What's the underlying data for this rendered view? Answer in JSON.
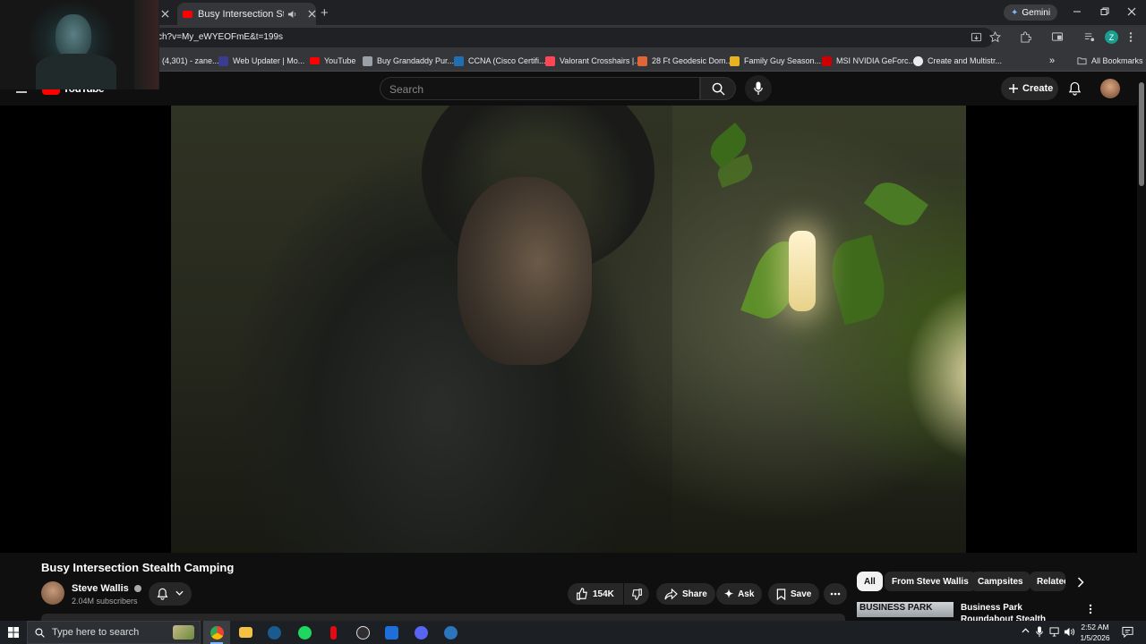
{
  "browser": {
    "tabs": [
      {
        "title": "Busy Intersection Stealth Ca",
        "active": true,
        "audio": true
      }
    ],
    "new_tab": "+",
    "gemini_label": "Gemini",
    "url": "ch?v=My_eWYEOFmE&t=199s",
    "profile_initial": "Z",
    "bookmarks": [
      {
        "label": "(4,301) - zane...",
        "icon_color": "#1da1f2"
      },
      {
        "label": "Web Updater | Mo...",
        "icon_color": "#3b3b8f"
      },
      {
        "label": "YouTube",
        "icon_color": "#ff0000"
      },
      {
        "label": "Buy Grandaddy Pur...",
        "icon_color": "#9aa0a6"
      },
      {
        "label": "CCNA (Cisco Certifi...",
        "icon_color": "#1f6fb2"
      },
      {
        "label": "Valorant Crosshairs |...",
        "icon_color": "#ff4655"
      },
      {
        "label": "28 Ft Geodesic Dom...",
        "icon_color": "#e0663a"
      },
      {
        "label": "Family Guy Season...",
        "icon_color": "#e8b321"
      },
      {
        "label": "MSI NVIDIA GeForc...",
        "icon_color": "#cc0000"
      },
      {
        "label": "Create and Multistr...",
        "icon_color": "#111111"
      }
    ],
    "bookmarks_overflow": "»",
    "all_bookmarks": "All Bookmarks"
  },
  "youtube": {
    "logo_text": "YouTube",
    "search_placeholder": "Search",
    "create_label": "Create",
    "video": {
      "title": "Busy Intersection Stealth Camping",
      "channel": "Steve Wallis",
      "subscribers": "2.04M subscribers",
      "likes": "154K",
      "share_label": "Share",
      "ask_label": "Ask",
      "save_label": "Save"
    },
    "chips": [
      "All",
      "From Steve Wallis",
      "Campsites",
      "Relatec"
    ],
    "recommendation": {
      "thumb_text": "BUSINESS PARK",
      "title": "Business Park Roundabout Stealth Camping"
    }
  },
  "taskbar": {
    "search_placeholder": "Type here to search",
    "time": "2:52 AM",
    "date": "1/5/2026"
  },
  "colors": {
    "youtube_red": "#ff0000",
    "page_bg": "#0f0f0f",
    "chip_active": "#f1f1f1"
  }
}
